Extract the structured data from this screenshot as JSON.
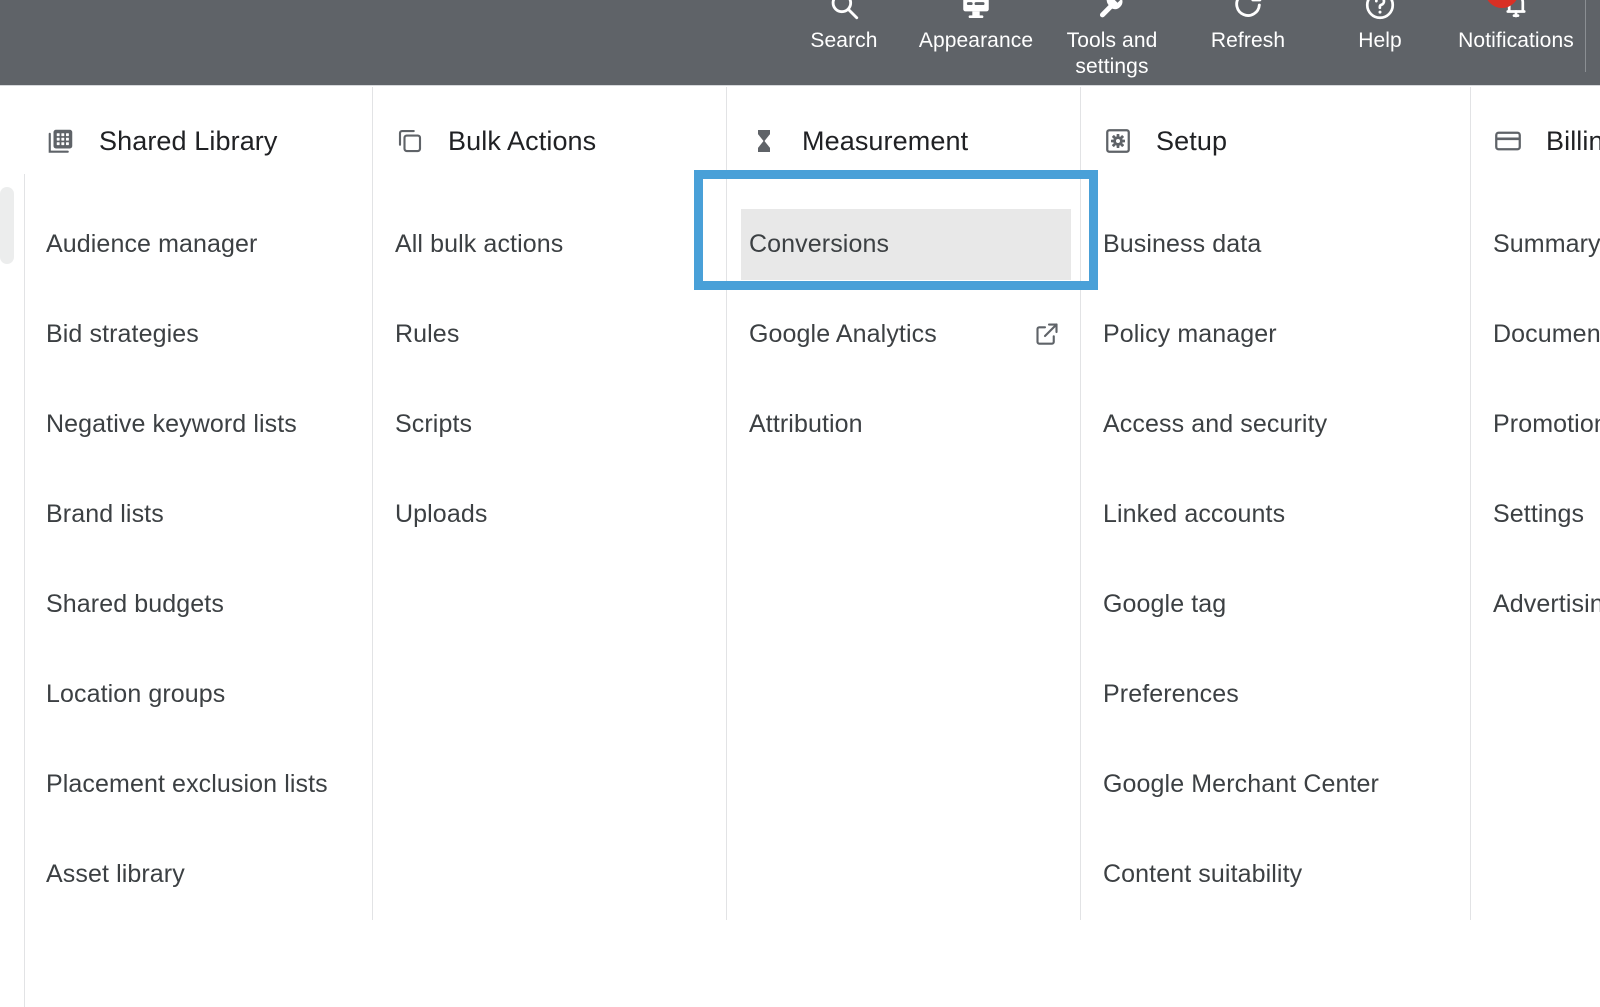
{
  "colors": {
    "topbar_bg": "#5f6368",
    "highlight_blue": "#49a0d8",
    "hover_gray": "#e8e8e8",
    "badge_red": "#d93025",
    "text_primary": "#3c4043",
    "divider": "#e2e3e5"
  },
  "topbar": {
    "items": [
      {
        "label": "Search",
        "icon": "search-icon"
      },
      {
        "label": "Appearance",
        "icon": "appearance-icon"
      },
      {
        "label": "Tools and\nsettings",
        "icon": "tools-and-settings-icon"
      },
      {
        "label": "Refresh",
        "icon": "refresh-icon"
      },
      {
        "label": "Help",
        "icon": "help-icon"
      },
      {
        "label": "Notifications",
        "icon": "notifications-bell-icon",
        "badge": true
      }
    ]
  },
  "menu": {
    "columns": [
      {
        "title": "Shared Library",
        "icon": "grid-library-icon",
        "items": [
          {
            "label": "Audience manager"
          },
          {
            "label": "Bid strategies"
          },
          {
            "label": "Negative keyword lists"
          },
          {
            "label": "Brand lists"
          },
          {
            "label": "Shared budgets"
          },
          {
            "label": "Location groups"
          },
          {
            "label": "Placement exclusion lists"
          },
          {
            "label": "Asset library"
          }
        ]
      },
      {
        "title": "Bulk Actions",
        "icon": "copy-layers-icon",
        "items": [
          {
            "label": "All bulk actions"
          },
          {
            "label": "Rules"
          },
          {
            "label": "Scripts"
          },
          {
            "label": "Uploads"
          }
        ]
      },
      {
        "title": "Measurement",
        "icon": "hourglass-icon",
        "items": [
          {
            "label": "Conversions",
            "highlighted": true,
            "hovered": true
          },
          {
            "label": "Google Analytics",
            "external": true
          },
          {
            "label": "Attribution"
          }
        ]
      },
      {
        "title": "Setup",
        "icon": "gear-box-icon",
        "items": [
          {
            "label": "Business data"
          },
          {
            "label": "Policy manager"
          },
          {
            "label": "Access and security"
          },
          {
            "label": "Linked accounts"
          },
          {
            "label": "Google tag"
          },
          {
            "label": "Preferences"
          },
          {
            "label": "Google Merchant Center"
          },
          {
            "label": "Content suitability"
          }
        ]
      },
      {
        "title": "Billing",
        "icon": "credit-card-icon",
        "items": [
          {
            "label": "Summary"
          },
          {
            "label": "Documents"
          },
          {
            "label": "Promotions"
          },
          {
            "label": "Settings"
          },
          {
            "label": "Advertising"
          }
        ]
      }
    ]
  }
}
